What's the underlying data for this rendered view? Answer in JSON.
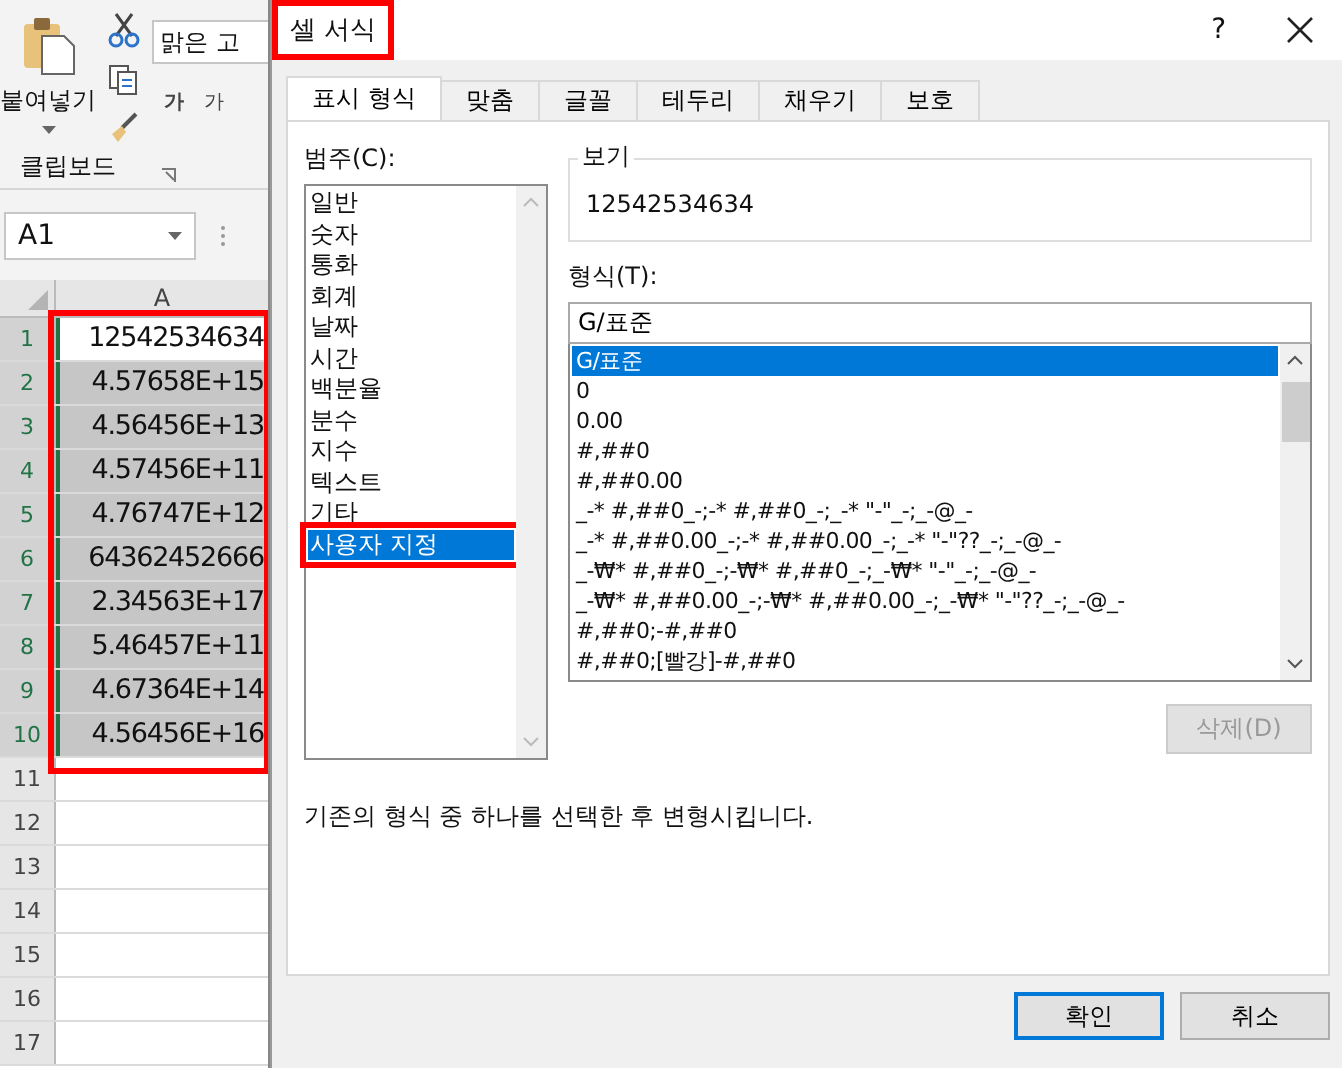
{
  "excel": {
    "ribbon": {
      "paste_label": "붙여넣기",
      "font_name": "맑은 고",
      "font_buttons": [
        "가",
        "가"
      ],
      "group_label": "클립보드"
    },
    "name_box": "A1",
    "column_header": "A",
    "rows": [
      {
        "number": "1",
        "value": "12542534634",
        "selected": true,
        "active": true
      },
      {
        "number": "2",
        "value": "4.57658E+15",
        "selected": true,
        "active": false
      },
      {
        "number": "3",
        "value": "4.56456E+13",
        "selected": true,
        "active": false
      },
      {
        "number": "4",
        "value": "4.57456E+11",
        "selected": true,
        "active": false
      },
      {
        "number": "5",
        "value": "4.76747E+12",
        "selected": true,
        "active": false
      },
      {
        "number": "6",
        "value": "64362452666",
        "selected": true,
        "active": false
      },
      {
        "number": "7",
        "value": "2.34563E+17",
        "selected": true,
        "active": false
      },
      {
        "number": "8",
        "value": "5.46457E+11",
        "selected": true,
        "active": false
      },
      {
        "number": "9",
        "value": "4.67364E+14",
        "selected": true,
        "active": false
      },
      {
        "number": "10",
        "value": "4.56456E+16",
        "selected": true,
        "active": false
      },
      {
        "number": "11"
      },
      {
        "number": "12"
      },
      {
        "number": "13"
      },
      {
        "number": "14"
      },
      {
        "number": "15"
      },
      {
        "number": "16"
      },
      {
        "number": "17"
      }
    ],
    "cells_highlighted": true
  },
  "dialog": {
    "title": "셀 서식",
    "title_highlighted": true,
    "help": "?",
    "tabs": [
      {
        "label": "표시 형식",
        "selected": true
      },
      {
        "label": "맞춤",
        "selected": false
      },
      {
        "label": "글꼴",
        "selected": false
      },
      {
        "label": "테두리",
        "selected": false
      },
      {
        "label": "채우기",
        "selected": false
      },
      {
        "label": "보호",
        "selected": false
      }
    ],
    "category_label": "범주(C):",
    "categories": [
      {
        "label": "일반",
        "selected": false
      },
      {
        "label": "숫자",
        "selected": false
      },
      {
        "label": "통화",
        "selected": false
      },
      {
        "label": "회계",
        "selected": false
      },
      {
        "label": "날짜",
        "selected": false
      },
      {
        "label": "시간",
        "selected": false
      },
      {
        "label": "백분율",
        "selected": false
      },
      {
        "label": "분수",
        "selected": false
      },
      {
        "label": "지수",
        "selected": false
      },
      {
        "label": "텍스트",
        "selected": false
      },
      {
        "label": "기타",
        "selected": false
      },
      {
        "label": "사용자 지정",
        "selected": true
      }
    ],
    "category_highlighted": true,
    "preview_label": "보기",
    "preview_value": "12542534634",
    "format_label": "형식(T):",
    "format_value": "G/표준",
    "formats": [
      {
        "label": "G/표준",
        "selected": true
      },
      {
        "label": "0",
        "selected": false
      },
      {
        "label": "0.00",
        "selected": false
      },
      {
        "label": "#,##0",
        "selected": false
      },
      {
        "label": "#,##0.00",
        "selected": false
      },
      {
        "label": "_-* #,##0_-;-* #,##0_-;_-* \"-\"_-;_-@_-",
        "selected": false
      },
      {
        "label": "_-* #,##0.00_-;-* #,##0.00_-;_-* \"-\"??_-;_-@_-",
        "selected": false
      },
      {
        "label": "_-₩* #,##0_-;-₩* #,##0_-;_-₩* \"-\"_-;_-@_-",
        "selected": false
      },
      {
        "label": "_-₩* #,##0.00_-;-₩* #,##0.00_-;_-₩* \"-\"??_-;_-@_-",
        "selected": false
      },
      {
        "label": "#,##0;-#,##0",
        "selected": false
      },
      {
        "label": "#,##0;[빨강]-#,##0",
        "selected": false
      }
    ],
    "delete_button": {
      "label": "삭제(D)",
      "disabled": true
    },
    "description": "기존의 형식 중 하나를 선택한 후 변형시킵니다.",
    "ok": "확인",
    "cancel": "취소"
  }
}
